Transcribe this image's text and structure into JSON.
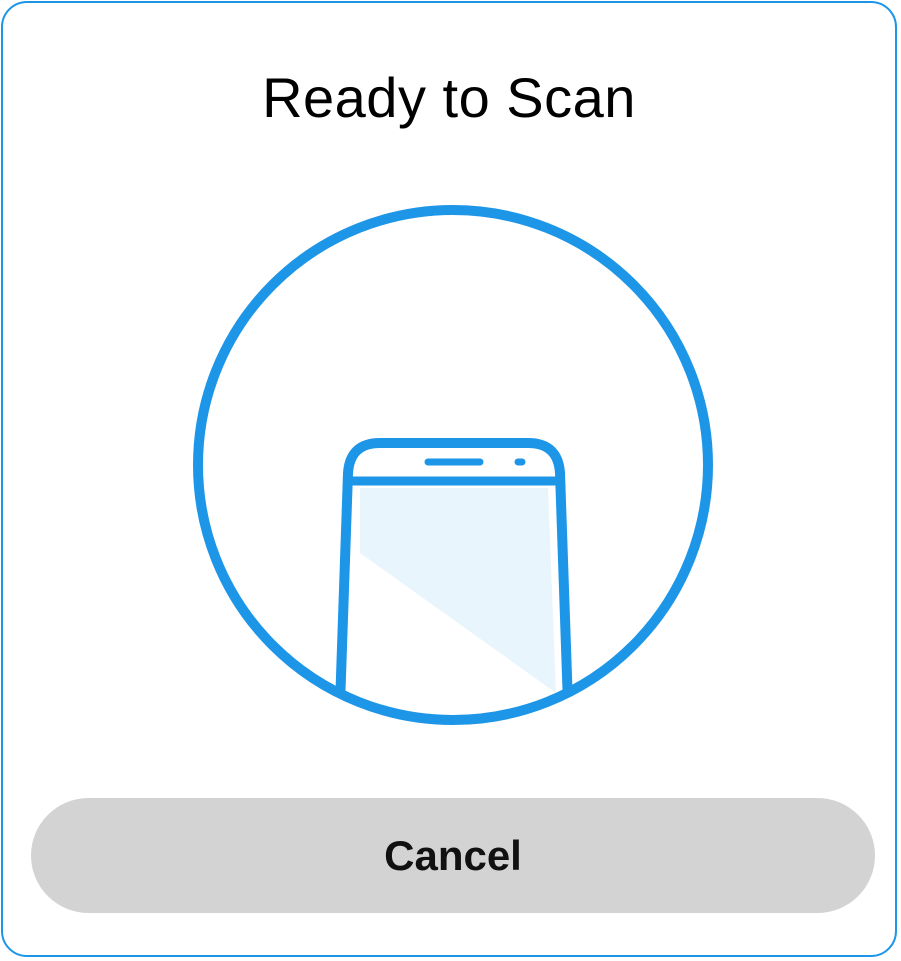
{
  "dialog": {
    "title": "Ready to Scan",
    "illustration_icon": "phone-scan-icon",
    "cancel_label": "Cancel"
  },
  "colors": {
    "accent": "#1e96e8",
    "screen_fill": "#e8f5fd",
    "button_bg": "#d3d3d3",
    "border": "#1e96e8"
  }
}
